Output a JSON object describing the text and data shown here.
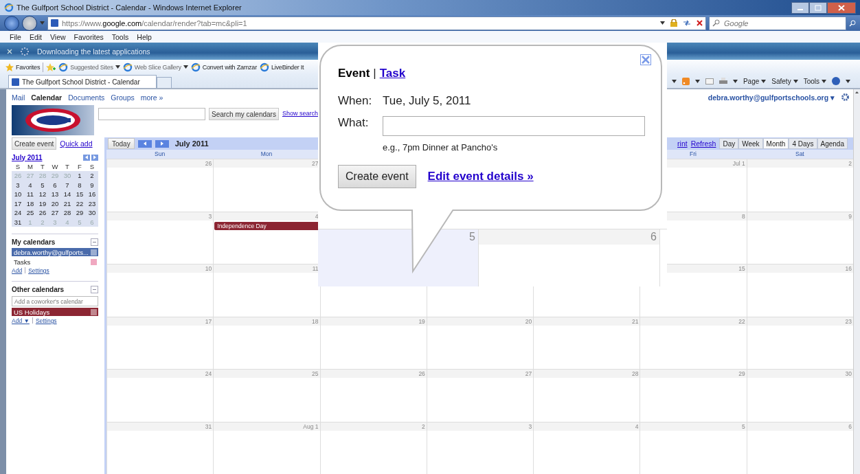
{
  "window": {
    "title": "The Gulfport School District - Calendar - Windows Internet Explorer"
  },
  "address_bar": {
    "url": "https://www.**google.com**/calendar/render?tab=mc&pli=1"
  },
  "search_box": {
    "placeholder": "Google"
  },
  "menu": [
    "File",
    "Edit",
    "View",
    "Favorites",
    "Tools",
    "Help"
  ],
  "notification": {
    "text": "Downloading the latest applications"
  },
  "favorites_bar": {
    "label": "Favorites",
    "items": [
      {
        "label": "Suggested Sites",
        "dropdown": true
      },
      {
        "label": "Web Slice Gallery",
        "dropdown": true
      },
      {
        "label": "Convert with Zamzar",
        "dropdown": false
      },
      {
        "label": "LiveBinder It",
        "dropdown": false
      }
    ]
  },
  "tabs": [
    {
      "label": "The Gulfport School District - Calendar",
      "selected": true
    }
  ],
  "command_bar": [
    "Page",
    "Safety",
    "Tools"
  ],
  "app_nav": [
    {
      "label": "Mail",
      "selected": false
    },
    {
      "label": "Calendar",
      "selected": true
    },
    {
      "label": "Documents",
      "selected": false
    },
    {
      "label": "Groups",
      "selected": false
    },
    {
      "label": "more »",
      "selected": false
    }
  ],
  "account": {
    "email": "debra.worthy@gulfportschools.org",
    "caret": "▾"
  },
  "search": {
    "button": "Search my calendars",
    "link": "Show search"
  },
  "sidebar": {
    "create_event": "Create event",
    "quick_add": "Quick add",
    "mini_calendar": {
      "title": "July 2011",
      "weekdays": [
        "S",
        "M",
        "T",
        "W",
        "T",
        "F",
        "S"
      ],
      "weeks": [
        [
          {
            "day": "26",
            "muted": true
          },
          {
            "day": "27",
            "muted": true
          },
          {
            "day": "28",
            "muted": true
          },
          {
            "day": "29",
            "muted": true
          },
          {
            "day": "30",
            "muted": true
          },
          {
            "day": "1",
            "muted": false
          },
          {
            "day": "2",
            "muted": false
          }
        ],
        [
          {
            "day": "3",
            "muted": false
          },
          {
            "day": "4",
            "muted": false
          },
          {
            "day": "5",
            "muted": false
          },
          {
            "day": "6",
            "muted": false
          },
          {
            "day": "7",
            "muted": false
          },
          {
            "day": "8",
            "muted": false
          },
          {
            "day": "9",
            "muted": false
          }
        ],
        [
          {
            "day": "10",
            "muted": false
          },
          {
            "day": "11",
            "muted": false
          },
          {
            "day": "12",
            "muted": false
          },
          {
            "day": "13",
            "muted": false
          },
          {
            "day": "14",
            "muted": false
          },
          {
            "day": "15",
            "muted": false
          },
          {
            "day": "16",
            "muted": false
          }
        ],
        [
          {
            "day": "17",
            "muted": false
          },
          {
            "day": "18",
            "muted": false
          },
          {
            "day": "19",
            "muted": false
          },
          {
            "day": "20",
            "muted": false
          },
          {
            "day": "21",
            "muted": false
          },
          {
            "day": "22",
            "muted": false
          },
          {
            "day": "23",
            "muted": false
          }
        ],
        [
          {
            "day": "24",
            "muted": false
          },
          {
            "day": "25",
            "muted": false
          },
          {
            "day": "26",
            "muted": false
          },
          {
            "day": "27",
            "muted": false
          },
          {
            "day": "28",
            "muted": false
          },
          {
            "day": "29",
            "muted": false
          },
          {
            "day": "30",
            "muted": false
          }
        ],
        [
          {
            "day": "31",
            "muted": false
          },
          {
            "day": "1",
            "muted": true
          },
          {
            "day": "2",
            "muted": true
          },
          {
            "day": "3",
            "muted": true
          },
          {
            "day": "4",
            "muted": true
          },
          {
            "day": "5",
            "muted": true
          },
          {
            "day": "6",
            "muted": true
          }
        ]
      ]
    },
    "my_calendars": {
      "title": "My calendars",
      "items": [
        {
          "name": "debra.worthy@gulfports...",
          "selected": true,
          "color": "#4a6bab"
        },
        {
          "name": "Tasks",
          "selected": false,
          "color": "#f0a8c0"
        }
      ],
      "links": [
        "Add",
        "Settings"
      ]
    },
    "other_calendars": {
      "title": "Other calendars",
      "placeholder": "Add a coworker's calendar",
      "items": [
        {
          "name": "US Holidays",
          "selected": true,
          "color": "#8c2633"
        }
      ],
      "links": [
        "Add ▼",
        "Settings"
      ]
    }
  },
  "toolbar": {
    "today": "Today",
    "period": "July 2011",
    "links": [
      "rint",
      "Refresh"
    ],
    "views": [
      {
        "label": "Day",
        "selected": false
      },
      {
        "label": "Week",
        "selected": false
      },
      {
        "label": "Month",
        "selected": true
      },
      {
        "label": "4 Days",
        "selected": false
      },
      {
        "label": "Agenda",
        "selected": false
      }
    ]
  },
  "grid": {
    "weekdays": {
      "start": [
        "Sun",
        "Mon"
      ],
      "end": [
        "Fri",
        "Sat"
      ]
    },
    "weeks": [
      {
        "start": [
          {
            "day": "26"
          },
          {
            "day": "27"
          }
        ],
        "end": [
          {
            "day": "Jul 1"
          },
          {
            "day": "2"
          }
        ]
      },
      {
        "start": [
          {
            "day": "3"
          },
          {
            "day": "4",
            "events": [
              {
                "title": "Independence Day",
                "color": "#8c2633"
              }
            ]
          }
        ],
        "end": [
          {
            "day": "8"
          },
          {
            "day": "9"
          }
        ]
      },
      {
        "start": [
          {
            "day": "10"
          },
          {
            "day": "11"
          }
        ],
        "end": [
          {
            "day": "15"
          },
          {
            "day": "16"
          }
        ]
      },
      {
        "days": [
          {
            "day": "17"
          },
          {
            "day": "18"
          },
          {
            "day": "19"
          },
          {
            "day": "20"
          },
          {
            "day": "21"
          },
          {
            "day": "22"
          },
          {
            "day": "23"
          }
        ]
      },
      {
        "days": [
          {
            "day": "24"
          },
          {
            "day": "25"
          },
          {
            "day": "26"
          },
          {
            "day": "27"
          },
          {
            "day": "28"
          },
          {
            "day": "29"
          },
          {
            "day": "30"
          }
        ]
      },
      {
        "days": [
          {
            "day": "31"
          },
          {
            "day": "Aug 1"
          },
          {
            "day": "2"
          },
          {
            "day": "3"
          },
          {
            "day": "4"
          },
          {
            "day": "5"
          },
          {
            "day": "6"
          }
        ]
      }
    ]
  },
  "popup": {
    "separator": "|",
    "tabs": [
      {
        "label": "Event",
        "selected": true
      },
      {
        "label": "Task",
        "selected": false
      }
    ],
    "when_label": "When:",
    "when": "Tue, July 5, 2011",
    "what_label": "What:",
    "hint": "e.g., 7pm Dinner at Pancho's",
    "create": "Create event",
    "edit_link": "Edit event details »",
    "zoom_cells": [
      {
        "day": "5",
        "selected": true
      },
      {
        "day": "6",
        "selected": false
      }
    ]
  }
}
